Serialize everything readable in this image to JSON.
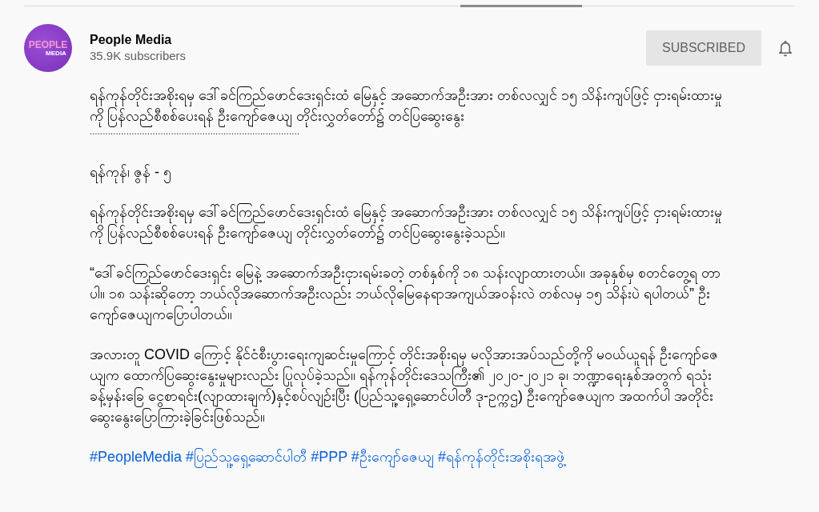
{
  "channel": {
    "avatar_logo": {
      "top": "PEOPLE",
      "bottom": "MEDIA"
    },
    "name": "People Media",
    "subscribers": "35.9K subscribers",
    "subscribe_button": "SUBSCRIBED"
  },
  "description": {
    "paragraphs": [
      {
        "kind": "text",
        "text": "ရန်ကုန်တိုင်းအစိုးရမှ ဒေါ်ခင်ကြည်ဖောင်ဒေးရှင်းထံ မြေနှင့် အဆောက်အဦးအား တစ်လလျှင် ၁၅ သိန်းကျပ်ဖြင့် ငှားရမ်းထားမှု ကို ပြန်လည်စီစစ်ပေးရန် ဦးကျော်ဇေယျ တိုင်းလွှတ်တော်၌ တင်ပြဆွေးနွေး"
      },
      {
        "kind": "rule",
        "text": "................................................................................"
      },
      {
        "kind": "text",
        "text": "ရန်ကုန်၊ ဇွန် - ၅"
      },
      {
        "kind": "text",
        "text": "ရန်ကုန်တိုင်းအစိုးရမှ ဒေါ်ခင်ကြည်ဖောင်ဒေးရှင်းထံ မြေနှင့် အဆောက်အဦးအား တစ်လလျှင် ၁၅ သိန်းကျပ်ဖြင့် ငှားရမ်းထားမှု ကို ပြန်လည်စီစစ်ပေးရန် ဦးကျော်ဇေယျ တိုင်းလွှတ်တော်၌ တင်ပြဆွေးနွေးခဲ့သည်။"
      },
      {
        "kind": "text",
        "text": "“ဒေါ်ခင်ကြည်ဖောင်ဒေးရှင်း မြေနဲ့ အဆောက်အဦးငှားရမ်းခတဲ့ တစ်နှစ်ကို ၁၈ သန်းလျာထားတယ်။ အခုနှစ်မှ စတင်တွေ့ရ တာပါ။ ၁၈ သန်းဆိုတော့ ဘယ်လိုအဆောက်အဦးလည်း ဘယ်လိုမြေနေရာအကျယ်အဝန်းလဲ တစ်လမှ ၁၅ သိန်းပဲ ရပါတယ်” ဦးကျော်ဇေယျကပြောပါတယ်။"
      },
      {
        "kind": "text",
        "text": "အလားတူ COVID ကြောင့် နိုင်ငံစီးပွားရေးကျဆင်းမှုကြောင့် တိုင်းအစိုးရမှ မလိုအားအပ်သည်တို့ကို မဝယ်ယူရန် ဦးကျော်ဇေ ယျက ထောက်ပြဆွေးနွေးမှုများလည်း ပြုလုပ်ခဲ့သည်။ ရန်ကုန်တိုင်းဒေသကြီး၏ ၂၀၂၀-၂၀၂၁ ခု၊ ဘဏ္ဍာရေးနှစ်အတွက် ရသုံးခန့်မှန်းခြေ ငွေစာရင်း(လျာထားချက်)နှင့်စပ်လျဉ်းပြီး (ပြည်သူ့ရှေ့ဆောင်ပါတီ ဒု-ဥက္ကဌ) ဦးကျော်ဇေယျက အထက်ပါ အတိုင်း ဆွေးနွေးပြောကြားခဲ့ခြင်းဖြစ်သည်။"
      }
    ],
    "hashtags": [
      "#PeopleMedia",
      "#ပြည်သူ့ရှေ့ဆောင်ပါတီ",
      "#PPP",
      "#ဦးကျော်ဇေယျ",
      "#ရန်ကုန်တိုင်းအစိုးရအဖွဲ့"
    ]
  }
}
